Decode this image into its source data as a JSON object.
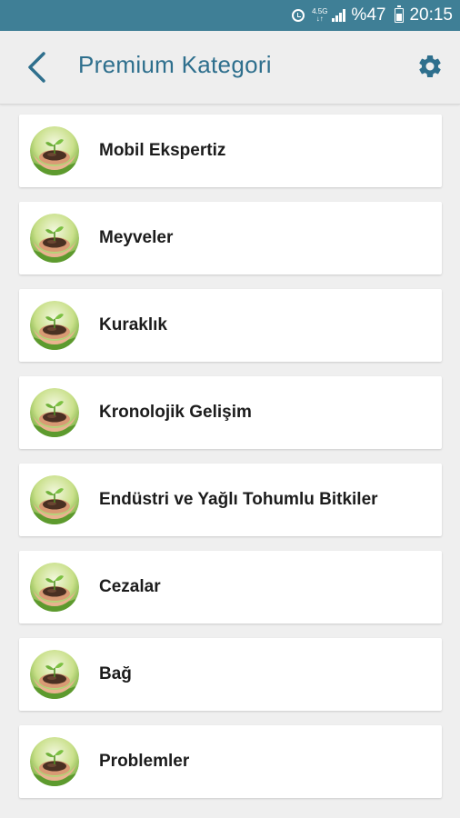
{
  "status_bar": {
    "network_top": "4.5G",
    "network_bottom": "↓↑",
    "battery": "%47",
    "time": "20:15"
  },
  "header": {
    "title": "Premium Kategori",
    "back_icon": "chevron-left-icon",
    "settings_icon": "gear-icon"
  },
  "categories": [
    {
      "label": "Mobil Ekspertiz"
    },
    {
      "label": "Meyveler"
    },
    {
      "label": "Kuraklık"
    },
    {
      "label": "Kronolojik Gelişim"
    },
    {
      "label": "Endüstri ve Yağlı Tohumlu Bitkiler"
    },
    {
      "label": "Cezalar"
    },
    {
      "label": "Bağ"
    },
    {
      "label": "Problemler"
    }
  ],
  "colors": {
    "status_bar": "#3f7f96",
    "accent": "#2e6f8d",
    "background": "#efefef"
  }
}
